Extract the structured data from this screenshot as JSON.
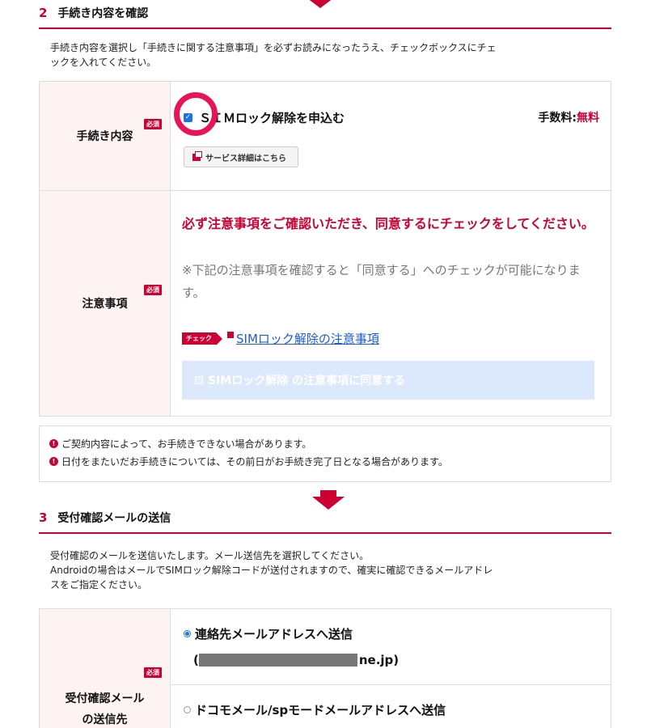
{
  "section2": {
    "number": "2",
    "title": "手続き内容を確認",
    "description_line1": "手続き内容を選択し「手続きに関する注意事項」を必ずお読みになったうえ、チェックボックスにチェ",
    "description_line2": "ックを入れてください。",
    "required_badge": "必須",
    "procedure_label": "手続き内容",
    "procedure_option": "ＳＩＭロック解除を申込む",
    "fee_label": "手数料:",
    "fee_value": "無料",
    "service_detail_button": "サービス詳細はこちら",
    "notice_label": "注意事項",
    "notice_red": "必ず注意事項をご確認いただき、同意するにチェックをしてください。",
    "notice_gray": "※下記の注意事項を確認すると「同意する」へのチェックが可能になります。",
    "check_tag": "チェック",
    "notice_link": "SIMロック解除の注意事項",
    "agree_label": "SIMロック解除 の注意事項に同意する",
    "warnings": [
      "ご契約内容によって、お手続きできない場合があります。",
      "日付をまたいだお手続きについては、その前日がお手続き完了日となる場合があります。"
    ]
  },
  "section3": {
    "number": "3",
    "title": "受付確認メールの送信",
    "description_line1": "受付確認のメールを送信いたします。メール送信先を選択してください。",
    "description_line2": "Androidの場合はメールでSIMロック解除コードが送付されますので、確実に確認できるメールアドレ",
    "description_line3": "スをご指定ください。",
    "required_badge": "必須",
    "label_line1": "受付確認メール",
    "label_line2": "の送信先",
    "option1": "連絡先メールアドレスへ送信",
    "option1_email_prefix": "(",
    "option1_email_suffix": "ne.jp)",
    "option2": "ドコモメール/spモードメールアドレスへ送信"
  },
  "colors": {
    "accent": "#cc0033",
    "label_bg": "#fdf3f3",
    "link": "#1a5ad7",
    "agree_bg": "#dce8fc",
    "highlight_ring": "#e8145a"
  }
}
